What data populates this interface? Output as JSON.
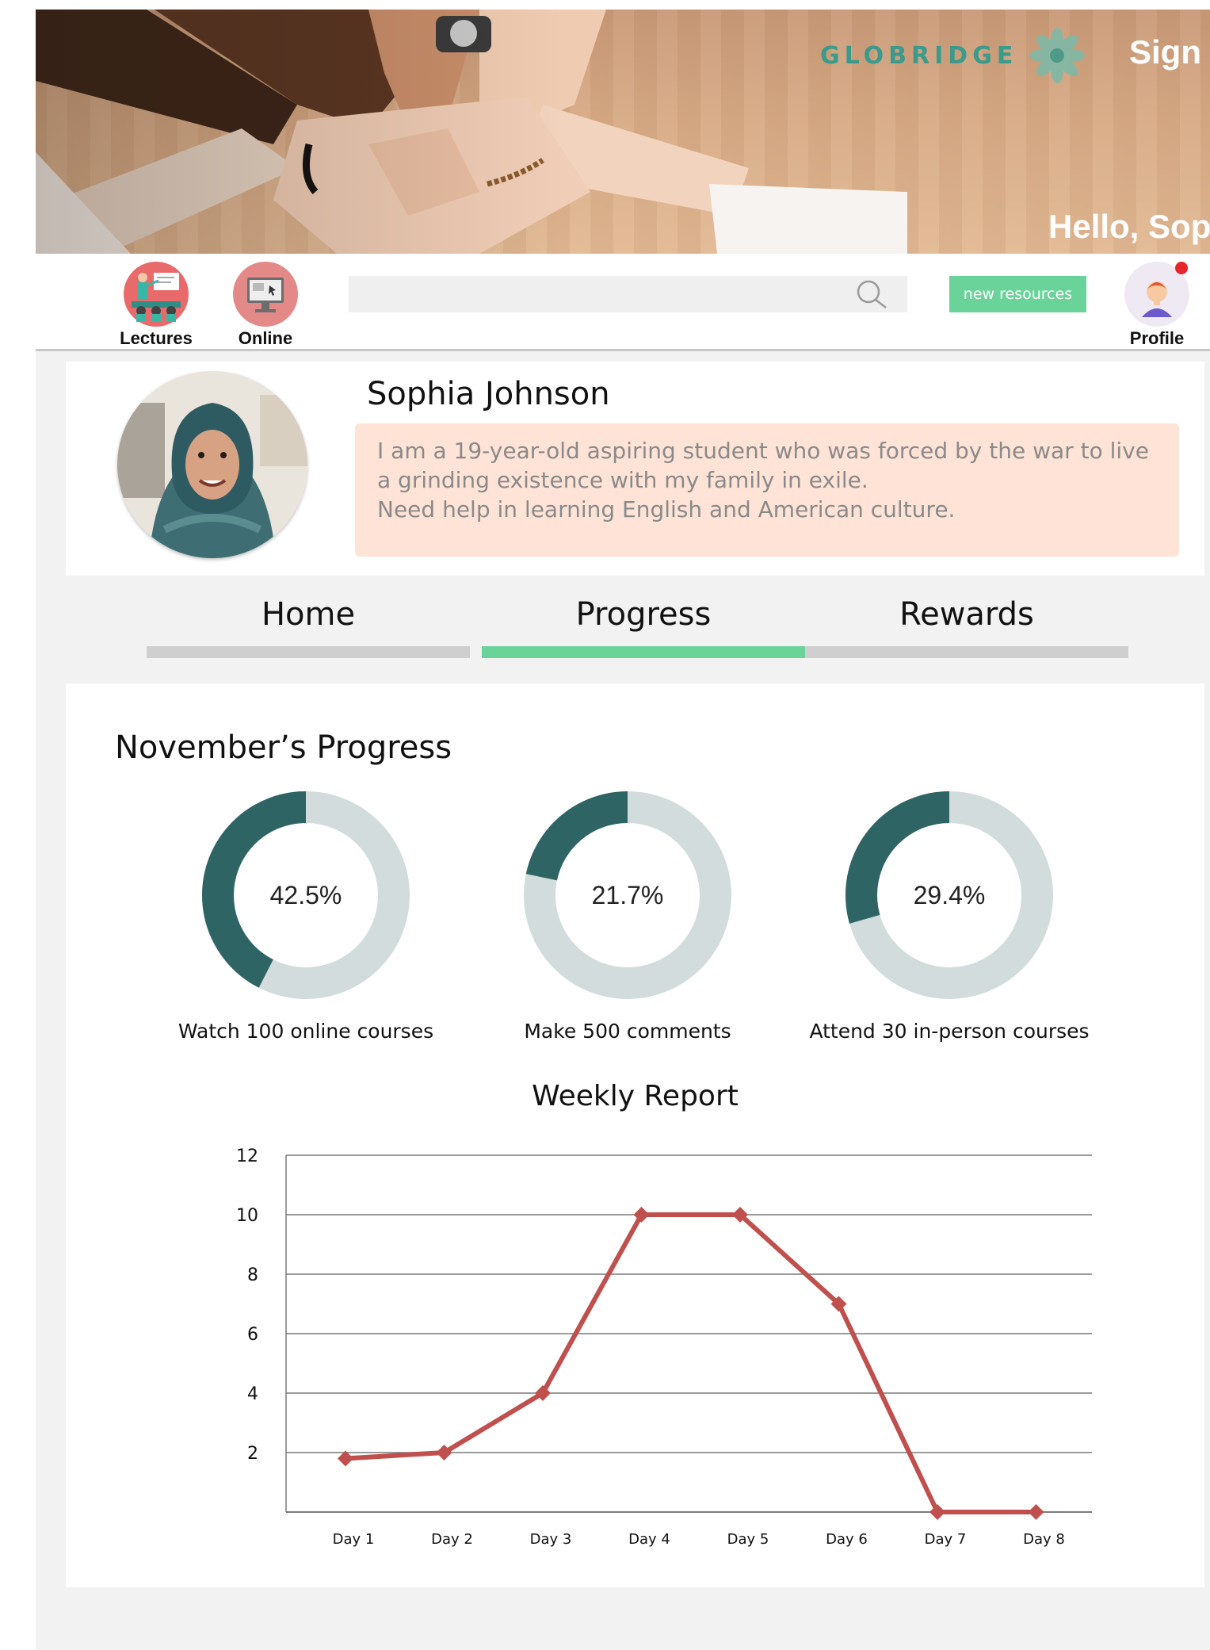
{
  "header": {
    "brand": "GLOBRIDGE",
    "sign_out": "Sign Ou",
    "greeting": "Hello, Sophia"
  },
  "nav": {
    "lectures_label": "Lectures",
    "online_label": "Online",
    "search_value": "",
    "new_resources_label": "new resources",
    "profile_label": "Profile"
  },
  "profile": {
    "name": "Sophia Johnson",
    "bio_lines": [
      "I am a 19-year-old aspiring student who was forced by the war to live",
      "a grinding existence with my family in exile.",
      "Need help in learning English and American culture."
    ]
  },
  "tabs": [
    {
      "label": "Home",
      "active": false
    },
    {
      "label": "Progress",
      "active": true
    },
    {
      "label": "Rewards",
      "active": false
    }
  ],
  "progress": {
    "title": "November’s Progress",
    "weekly_title": "Weekly Report"
  },
  "colors": {
    "accent_green": "#6ad39a",
    "donut_fill": "#2f6465",
    "donut_track": "#d3dcdc",
    "line_color": "#c0504d",
    "bio_bg": "#ffe3d6",
    "brand_teal": "#3a9a8c"
  },
  "chart_data": [
    {
      "type": "pie",
      "variant": "donut",
      "value_percent": 42.5,
      "center_label": "42.5%",
      "caption": "Watch 100 online courses"
    },
    {
      "type": "pie",
      "variant": "donut",
      "value_percent": 21.7,
      "center_label": "21.7%",
      "caption": "Make 500 comments"
    },
    {
      "type": "pie",
      "variant": "donut",
      "value_percent": 29.4,
      "center_label": "29.4%",
      "caption": "Attend 30 in-person courses"
    },
    {
      "type": "line",
      "title": "Weekly Report",
      "categories": [
        "Day 1",
        "Day 2",
        "Day 3",
        "Day 4",
        "Day 5",
        "Day 6",
        "Day 7",
        "Day 8"
      ],
      "values": [
        1.8,
        2,
        4,
        10,
        10,
        7,
        0,
        0
      ],
      "y_ticks": [
        2,
        4,
        6,
        8,
        10,
        12
      ],
      "ylim": [
        0,
        12
      ],
      "grid": true,
      "marker": "diamond"
    }
  ]
}
